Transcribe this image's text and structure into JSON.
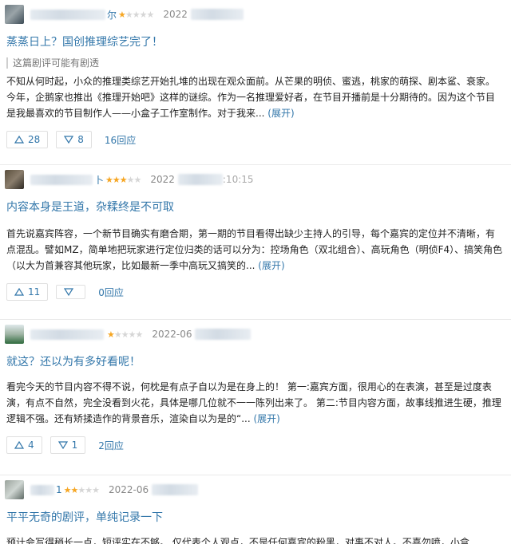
{
  "reviews": [
    {
      "username_visible": "尔",
      "rating": 1,
      "date": "2022",
      "title": "蒸蒸日上？国创推理综艺完了！",
      "spoiler": "这篇剧评可能有剧透",
      "body": "不知从何时起，小众的推理类综艺开始扎堆的出现在观众面前。从芒果的明侦、蜜逃，桃家的萌探、剧本鲨、衰家。今年，企鹅家也推出《推理开始吧》这样的谜综。作为一名推理爱好者，在节目开播前是十分期待的。因为这个节目是我最喜欢的节目制作人——小盒子工作室制作。对于我来...",
      "expand": "(展开)",
      "useful": "28",
      "useless": "8",
      "replies": "16回应"
    },
    {
      "username_visible": "卜",
      "rating": 3,
      "date": "2022",
      "time": ":10:15",
      "title": "内容本身是王道，杂糅终是不可取",
      "body": "首先说嘉宾阵容，一个新节目确实有磨合期，第一期的节目看得出缺少主持人的引导，每个嘉宾的定位并不清晰，有点混乱。譬如MZ，简单地把玩家进行定位归类的话可以分为：控场角色（双北组合）、高玩角色（明侦F4）、搞笑角色（以大为首兼容其他玩家，比如最新一季中高玩又搞笑的...",
      "expand": "(展开)",
      "useful": "11",
      "useless": "",
      "replies": "0回应"
    },
    {
      "username_visible": "",
      "rating": 1,
      "date": "2022-06",
      "title": "就这？还以为有多好看呢！",
      "body": "看完今天的节目内容不得不说，何枕是有点子自以为是在身上的！ 第一:嘉宾方面，很用心的在表演，甚至是过度表演，有点不自然，完全没看到火花，具体是哪几位就不一一陈列出来了。 第二:节目内容方面，故事线推进生硬，推理逻辑不强。还有矫揉造作的背景音乐，渲染自以为是的“...",
      "expand": "(展开)",
      "useful": "4",
      "useless": "1",
      "replies": "2回应"
    },
    {
      "username_visible": "1",
      "rating": 2,
      "date": "2022-06",
      "title": "平平无奇的剧评，单纯记录一下",
      "body": "预计会写得稍长一点，短评实在不够。 仅代表个人观点，不是任何嘉宾的粉黑，对事不对人。不喜勿喷，小盒"
    }
  ],
  "colors": {
    "link": "#3377aa",
    "star": "#f6a623"
  },
  "icons": {
    "useful": "thumb-up-triangle",
    "useless": "thumb-down-triangle"
  }
}
